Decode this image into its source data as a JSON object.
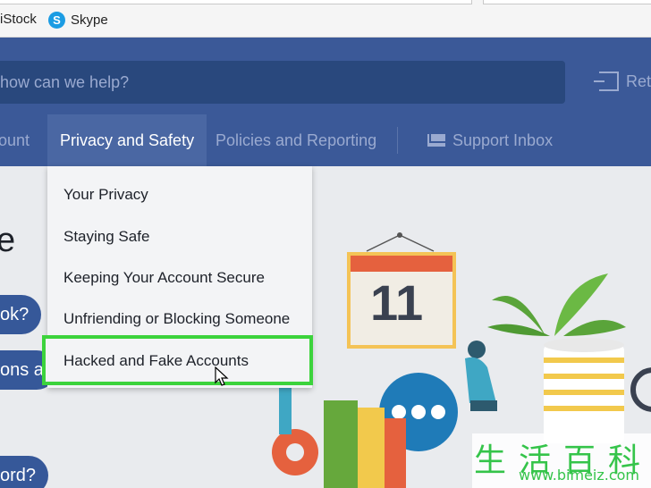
{
  "bookmarks": {
    "items": [
      {
        "label": "iStock"
      },
      {
        "label": "Skype",
        "icon": "skype-icon"
      }
    ]
  },
  "header": {
    "search_placeholder": "how can we help?",
    "return_label": "Ret"
  },
  "nav": {
    "items": [
      {
        "label": "ount"
      },
      {
        "label": "Privacy and Safety",
        "active": true
      },
      {
        "label": "Policies and Reporting"
      },
      {
        "label": "Support Inbox",
        "icon": "mail-icon"
      }
    ]
  },
  "content": {
    "hero_fragment": "e",
    "pills": [
      "ok?",
      "ons a",
      "ord?"
    ]
  },
  "dropdown": {
    "items": [
      "Your Privacy",
      "Staying Safe",
      "Keeping Your Account Secure",
      "Unfriending or Blocking Someone",
      "Hacked and Fake Accounts"
    ],
    "highlighted_index": 4,
    "highlight_color": "#3cd33c"
  },
  "illustration": {
    "calendar_number": "11"
  },
  "watermark": {
    "chars": "生活百科",
    "url": "www.bimeiz.com"
  },
  "colors": {
    "header_bg": "#3b5998",
    "search_bg": "#29487d",
    "active_tab_bg": "#4a67a3",
    "pill_bg": "#365899"
  }
}
